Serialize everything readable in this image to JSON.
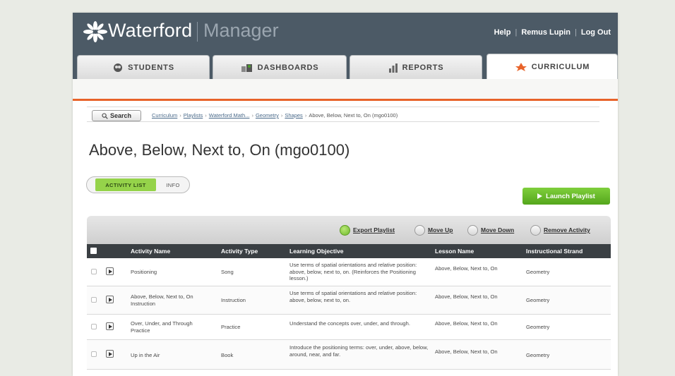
{
  "app": {
    "brand_name": "Waterford",
    "brand_sub": "Manager",
    "top_links": [
      "Help",
      "Remus Lupin",
      "Log Out"
    ],
    "logo_icon": "snowflake-leaf-logo"
  },
  "tabs": [
    {
      "label": "STUDENTS",
      "icon": "student-icon",
      "active": false
    },
    {
      "label": "DASHBOARDS",
      "icon": "dashboard-icon",
      "active": false
    },
    {
      "label": "REPORTS",
      "icon": "bar-chart-icon",
      "active": false
    },
    {
      "label": "CURRICULUM",
      "icon": "curriculum-icon",
      "active": true
    }
  ],
  "search": {
    "label": "Search",
    "icon": "magnifier-icon"
  },
  "breadcrumb": {
    "links": [
      "Curriculum",
      "Playlists",
      "Waterford Math...",
      "Geometry",
      "Shapes"
    ],
    "current": "Above, Below, Next to, On (mgo0100)"
  },
  "page": {
    "title": "Above, Below, Next to, On (mgo0100)"
  },
  "view_toggle": {
    "active": "ACTIVITY LIST",
    "inactive": "INFO"
  },
  "launch_button": {
    "label": "Launch Playlist",
    "icon": "play-icon"
  },
  "actions": {
    "export": "Export Playlist",
    "move_up": "Move Up",
    "move_down": "Move Down",
    "remove": "Remove Activity"
  },
  "table": {
    "columns": [
      "Activity Name",
      "Activity Type",
      "Learning Objective",
      "Lesson Name",
      "Instructional Strand"
    ],
    "rows": [
      {
        "name": "Positioning",
        "type": "Song",
        "objective": "Use terms of spatial orientations and relative position: above, below, next to, on. (Reinforces the Positioning lesson.)",
        "lesson": "Above, Below, Next to, On",
        "strand": "Geometry"
      },
      {
        "name": "Above, Below, Next to, On Instruction",
        "type": "Instruction",
        "objective": "Use terms of spatial orientations and relative position: above, below, next to, on.",
        "lesson": "Above, Below, Next to, On",
        "strand": "Geometry"
      },
      {
        "name": "Over, Under, and Through Practice",
        "type": "Practice",
        "objective": "Understand the concepts over, under, and through.",
        "lesson": "Above, Below, Next to, On",
        "strand": "Geometry"
      },
      {
        "name": "Up in the Air",
        "type": "Book",
        "objective": "Introduce the positioning terms: over, under, above, below, around, near, and far.",
        "lesson": "Above, Below, Next to, On",
        "strand": "Geometry"
      }
    ]
  },
  "colors": {
    "header_bg": "#4c5a66",
    "accent_orange": "#e8632a",
    "launch_green": "#6fbd2e",
    "toggle_green": "#95d34a",
    "table_header": "#3a3f43"
  }
}
